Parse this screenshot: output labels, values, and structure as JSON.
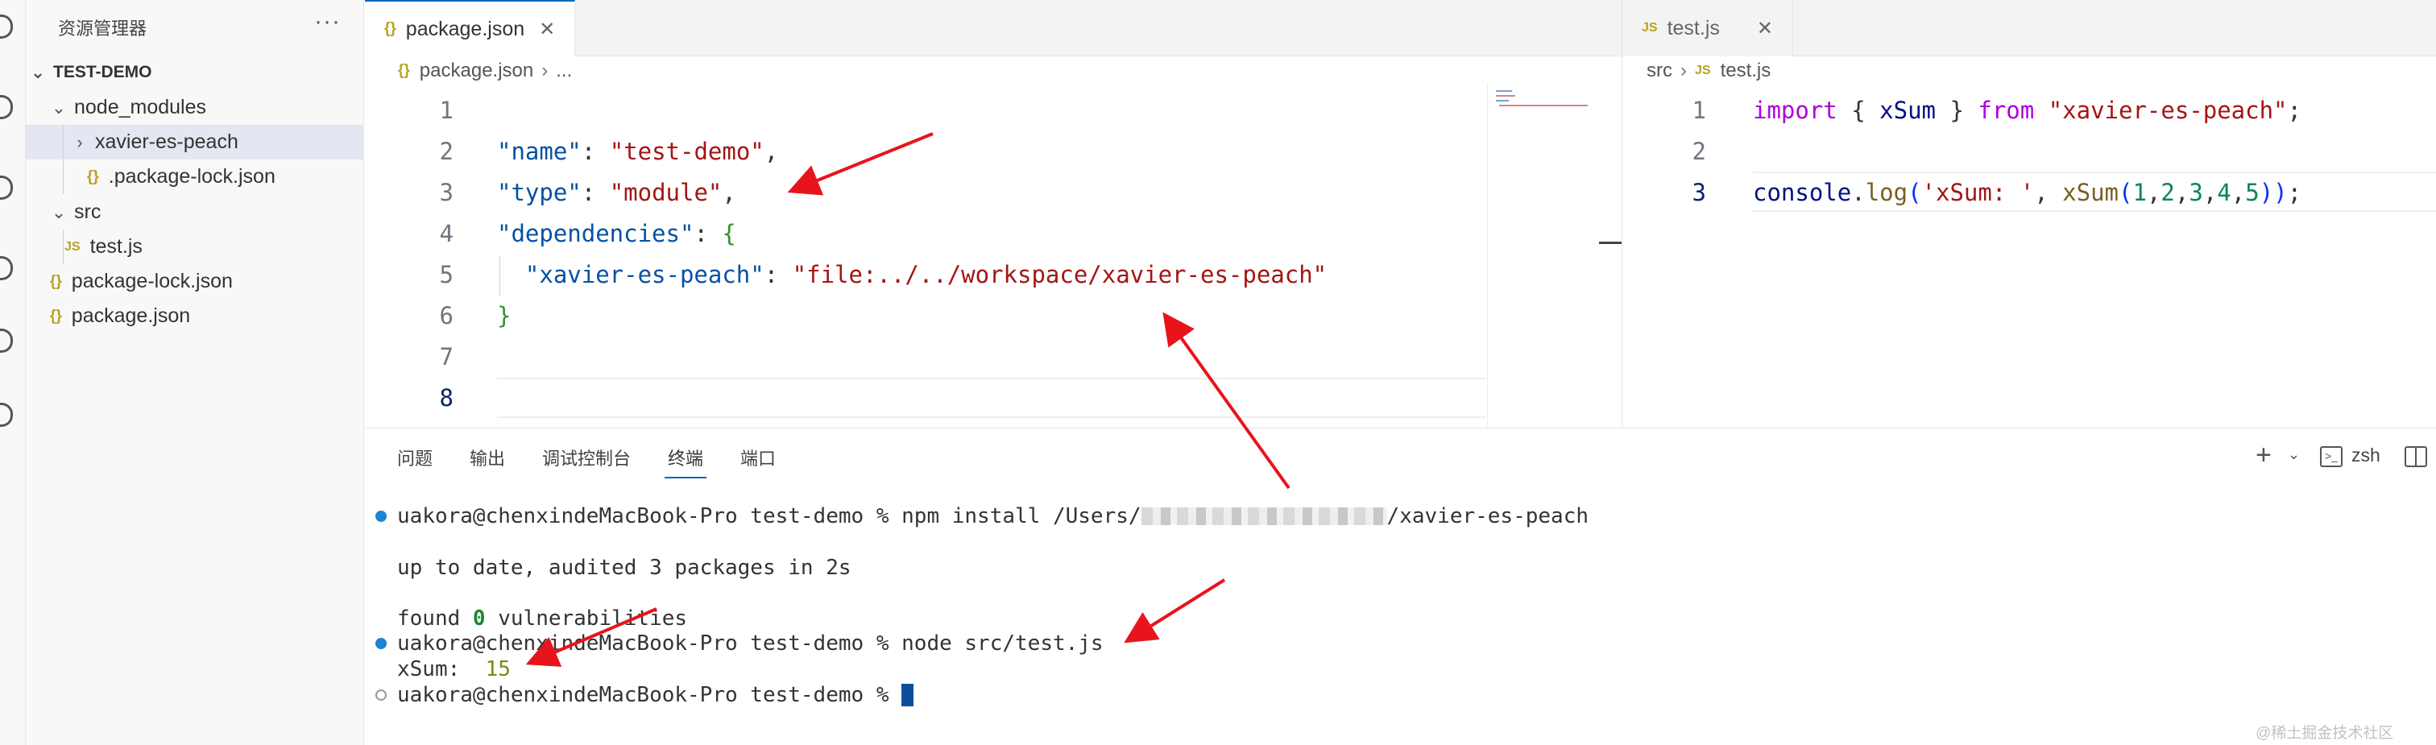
{
  "explorer": {
    "title": "资源管理器",
    "more": "···",
    "root": "TEST-DEMO",
    "items": [
      {
        "label": "node_modules",
        "chevron": "⌄",
        "icon": ""
      },
      {
        "label": "xavier-es-peach",
        "chevron": "›",
        "icon": ""
      },
      {
        "label": ".package-lock.json",
        "chevron": "",
        "icon": "{}"
      },
      {
        "label": "src",
        "chevron": "⌄",
        "icon": ""
      },
      {
        "label": "test.js",
        "chevron": "",
        "icon": "JS"
      },
      {
        "label": "package-lock.json",
        "chevron": "",
        "icon": "{}"
      },
      {
        "label": "package.json",
        "chevron": "",
        "icon": "{}"
      }
    ]
  },
  "left_editor": {
    "tab": {
      "icon": "{}",
      "label": "package.json",
      "close": "✕"
    },
    "more": "···",
    "breadcrumb": {
      "icon": "{}",
      "file": "package.json",
      "sep": "›",
      "rest": "..."
    },
    "line_numbers": [
      "1",
      "2",
      "3",
      "4",
      "5",
      "6",
      "7",
      "8"
    ],
    "lines": [
      [],
      [
        {
          "t": "\"name\"",
          "c": "k-key"
        },
        {
          "t": ": ",
          "c": "k-punc"
        },
        {
          "t": "\"test-demo\"",
          "c": "k-str"
        },
        {
          "t": ",",
          "c": "k-punc"
        }
      ],
      [
        {
          "t": "\"type\"",
          "c": "k-key"
        },
        {
          "t": ": ",
          "c": "k-punc"
        },
        {
          "t": "\"module\"",
          "c": "k-str"
        },
        {
          "t": ",",
          "c": "k-punc"
        }
      ],
      [
        {
          "t": "\"dependencies\"",
          "c": "k-key"
        },
        {
          "t": ": ",
          "c": "k-punc"
        },
        {
          "t": "{",
          "c": "k-brace"
        }
      ],
      [
        {
          "t": "  \"xavier-es-peach\"",
          "c": "k-key"
        },
        {
          "t": ": ",
          "c": "k-punc"
        },
        {
          "t": "\"file:../../workspace/xavier-es-peach\"",
          "c": "k-str"
        }
      ],
      [
        {
          "t": "}",
          "c": "k-brace"
        }
      ],
      [],
      []
    ]
  },
  "right_editor": {
    "tab": {
      "icon": "JS",
      "label": "test.js",
      "close": "✕"
    },
    "breadcrumb": {
      "folder": "src",
      "sep": "›",
      "icon": "JS",
      "file": "test.js"
    },
    "line_numbers": [
      "1",
      "2",
      "3"
    ],
    "lines": [
      [
        {
          "t": "import",
          "c": "k-kw"
        },
        {
          "t": " { ",
          "c": "k-punc"
        },
        {
          "t": "xSum",
          "c": "k-var"
        },
        {
          "t": " } ",
          "c": "k-punc"
        },
        {
          "t": "from",
          "c": "k-kw"
        },
        {
          "t": " ",
          "c": "k-punc"
        },
        {
          "t": "\"xavier-es-peach\"",
          "c": "k-str"
        },
        {
          "t": ";",
          "c": "k-punc"
        }
      ],
      [],
      [
        {
          "t": "console",
          "c": "k-var"
        },
        {
          "t": ".",
          "c": "k-punc"
        },
        {
          "t": "log",
          "c": "k-fn"
        },
        {
          "t": "(",
          "c": "k-paren"
        },
        {
          "t": "'xSum: '",
          "c": "k-str"
        },
        {
          "t": ", ",
          "c": "k-punc"
        },
        {
          "t": "xSum",
          "c": "k-fn"
        },
        {
          "t": "(",
          "c": "k-paren"
        },
        {
          "t": "1",
          "c": "k-num"
        },
        {
          "t": ",",
          "c": "k-punc"
        },
        {
          "t": "2",
          "c": "k-num"
        },
        {
          "t": ",",
          "c": "k-punc"
        },
        {
          "t": "3",
          "c": "k-num"
        },
        {
          "t": ",",
          "c": "k-punc"
        },
        {
          "t": "4",
          "c": "k-num"
        },
        {
          "t": ",",
          "c": "k-punc"
        },
        {
          "t": "5",
          "c": "k-num"
        },
        {
          "t": ")",
          "c": "k-paren"
        },
        {
          "t": ")",
          "c": "k-paren"
        },
        {
          "t": ";",
          "c": "k-punc"
        }
      ]
    ]
  },
  "panel": {
    "tabs": [
      "问题",
      "输出",
      "调试控制台",
      "终端",
      "端口"
    ],
    "active_tab": "终端",
    "add": "+",
    "chevron": "⌄",
    "shell_icon": ">_",
    "shell": "zsh",
    "terminal": {
      "line1_prefix": "uakora@chenxindeMacBook-Pro test-demo % npm install /Users/",
      "line1_suffix": "/xavier-es-peach",
      "line2": "up to date, audited 3 packages in 2s",
      "line3_prefix": "found ",
      "line3_num": "0",
      "line3_suffix": " vulnerabilities",
      "line4": "uakora@chenxindeMacBook-Pro test-demo % node src/test.js",
      "line5_prefix": "xSum:  ",
      "line5_num": "15",
      "line6": "uakora@chenxindeMacBook-Pro test-demo % "
    }
  },
  "watermark": "@稀土掘金技术社区",
  "colors": {
    "accent": "#0066bf",
    "arrow": "#e8141c"
  }
}
